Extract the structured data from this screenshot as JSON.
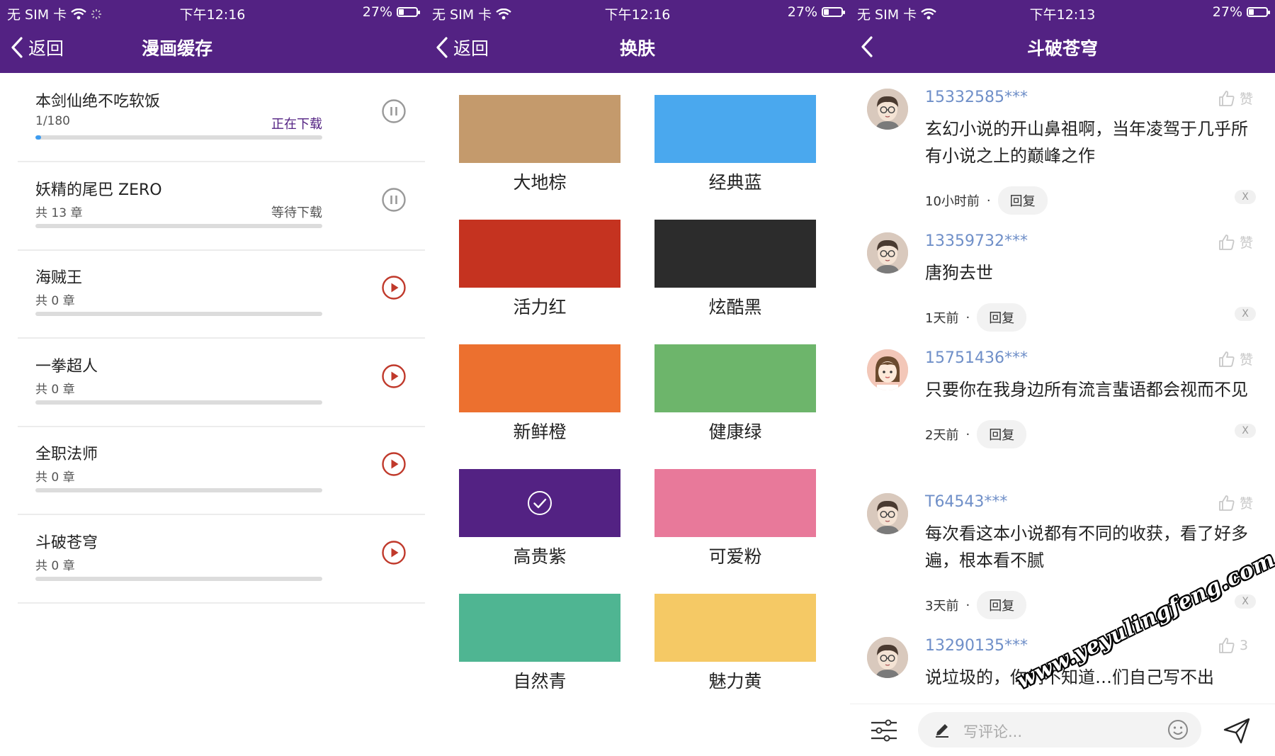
{
  "colors": {
    "header": "#532283",
    "progress": "#3d9cf0",
    "play": "#c0392b",
    "user": "#6f8fc8"
  },
  "panels": [
    {
      "status": {
        "carrier": "无 SIM 卡",
        "time": "下午12:16",
        "battery": "27%"
      },
      "back_label": "返回",
      "title": "漫画缓存",
      "items": [
        {
          "title": "本剑仙绝不吃软饭",
          "count": "1/180",
          "status": "正在下载",
          "progress": 0.02,
          "button": "pause-icon",
          "active": true
        },
        {
          "title": "妖精的尾巴 ZERO",
          "count": "共 13 章",
          "status": "等待下载",
          "progress": 0,
          "button": "pause-icon",
          "active": false
        },
        {
          "title": "海贼王",
          "count": "共 0 章",
          "status": "",
          "progress": 0,
          "button": "play-icon",
          "active": false
        },
        {
          "title": "一拳超人",
          "count": "共 0 章",
          "status": "",
          "progress": 0,
          "button": "play-icon",
          "active": false
        },
        {
          "title": "全职法师",
          "count": "共 0 章",
          "status": "",
          "progress": 0,
          "button": "play-icon",
          "active": false
        },
        {
          "title": "斗破苍穹",
          "count": "共 0 章",
          "status": "",
          "progress": 0,
          "button": "play-icon",
          "active": false
        }
      ]
    },
    {
      "status": {
        "carrier": "无 SIM 卡",
        "time": "下午12:16",
        "battery": "27%"
      },
      "back_label": "返回",
      "title": "换肤",
      "skins": [
        {
          "label": "大地棕",
          "color": "#c49a6c",
          "selected": false
        },
        {
          "label": "经典蓝",
          "color": "#4aa8ee",
          "selected": false
        },
        {
          "label": "活力红",
          "color": "#c53320",
          "selected": false
        },
        {
          "label": "炫酷黑",
          "color": "#2c2c2c",
          "selected": false
        },
        {
          "label": "新鲜橙",
          "color": "#ec702f",
          "selected": false
        },
        {
          "label": "健康绿",
          "color": "#6db56b",
          "selected": false
        },
        {
          "label": "高贵紫",
          "color": "#532283",
          "selected": true
        },
        {
          "label": "可爱粉",
          "color": "#e8799a",
          "selected": false
        },
        {
          "label": "自然青",
          "color": "#4fb592",
          "selected": false
        },
        {
          "label": "魅力黄",
          "color": "#f5c965",
          "selected": false
        }
      ]
    },
    {
      "status": {
        "carrier": "无 SIM 卡",
        "time": "下午12:13",
        "battery": "27%"
      },
      "title": "斗破苍穹",
      "comments": [
        {
          "user": "15332585***",
          "text": "玄幻小说的开山鼻祖啊，当年凌驾于几乎所有小说之上的巅峰之作",
          "time": "10小时前",
          "reply": "回复",
          "like": "赞",
          "avatar": "male"
        },
        {
          "user": "13359732***",
          "text": "唐狗去世",
          "time": "1天前",
          "reply": "回复",
          "like": "赞",
          "avatar": "male"
        },
        {
          "user": "15751436***",
          "text": "只要你在我身边所有流言蜚语都会视而不见",
          "time": "2天前",
          "reply": "回复",
          "like": "赞",
          "avatar": "female"
        },
        {
          "user": "T64543***",
          "text": "每次看这本小说都有不同的收获，看了好多遍，根本看不腻",
          "time": "3天前",
          "reply": "回复",
          "like": "赞",
          "avatar": "male"
        },
        {
          "user": "13290135***",
          "text": "说垃圾的，你们不知道…们自己写不出",
          "time": "",
          "reply": "",
          "like": "3",
          "avatar": "male"
        }
      ],
      "close_label": "X",
      "input_placeholder": "写评论..."
    }
  ],
  "watermark": "www.yeyulingfeng.com"
}
